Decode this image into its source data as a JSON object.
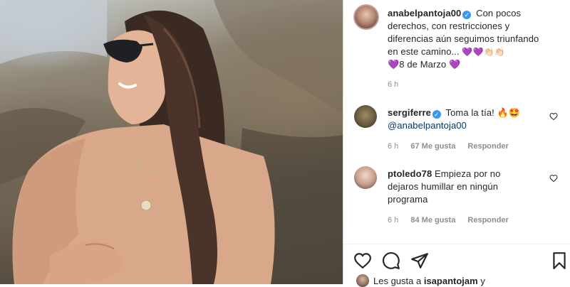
{
  "post": {
    "author": "anabelpantoja00",
    "caption_lines": [
      "Con pocos",
      "derechos, con restricciones y",
      "diferencias aún seguimos triunfando",
      "en este camino..."
    ],
    "caption_tail": "8 de Marzo",
    "caption_emojis": "💜💜👏🏻👏🏻",
    "time": "6 h"
  },
  "comments": [
    {
      "username": "sergiferre",
      "verified": true,
      "text": "Toma la tía!",
      "emoji": "🔥🤩",
      "mention": "@anabelpantoja00",
      "time": "6 h",
      "likes": "67 Me gusta",
      "reply": "Responder"
    },
    {
      "username": "ptoledo78",
      "verified": false,
      "text_lines": [
        "Empieza por no",
        "dejaros humillar en ningún",
        "programa"
      ],
      "time": "6 h",
      "likes": "84 Me gusta",
      "reply": "Responder"
    }
  ],
  "actions": {
    "like_icon": "heart-outline-icon",
    "comment_icon": "comment-bubble-icon",
    "share_icon": "paper-plane-icon",
    "save_icon": "bookmark-icon"
  },
  "likes_row": {
    "prefix": "Les gusta a",
    "user": "isapantojam",
    "suffix": "y"
  },
  "colors": {
    "verified": "#3897f0",
    "purple_heart": "#8e44ec",
    "meta_gray": "#8e8e8e",
    "text": "#262626"
  }
}
